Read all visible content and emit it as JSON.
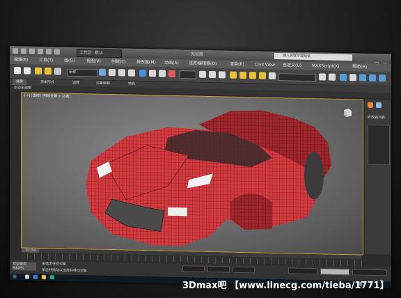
{
  "titlebar": {
    "workspace_label": "工作区: 默认",
    "file_title": "无标题",
    "search_placeholder": "键入关键字或短语"
  },
  "menubar": {
    "items": [
      "编辑(E)",
      "工具(T)",
      "组(G)",
      "视图(V)",
      "创建(C)",
      "修改器(M)",
      "动画(A)",
      "图形编辑器(D)",
      "渲染(R)",
      "Civil View",
      "自定义(U)",
      "MAXScript(X)",
      "帮助(H)"
    ]
  },
  "toolbar": {
    "selection_filter": "全部",
    "named_selection": ""
  },
  "ribbon": {
    "tabs": [
      "建模",
      "自由形式",
      "选择",
      "对象绘制",
      "填充"
    ],
    "active_tab": "建模",
    "sub_label": "多边形建模"
  },
  "viewport": {
    "label": "[+] [透视] [明暗处理 + 边面]",
    "border_color": "#c9a53b",
    "model_color": "#d23a3f",
    "model_name": "car-model"
  },
  "right_panel": {
    "label": "修改器列表"
  },
  "timeline": {
    "frame_counter": "0 / 100"
  },
  "status": {
    "line1": "未选定任何对象",
    "line2": "单击并拖动以选择并移动对象",
    "script_label": "欢迎使用 MAXSc"
  },
  "watermark": {
    "text": "3Dmax吧 【www.linecg.com/tieba/1771】"
  }
}
